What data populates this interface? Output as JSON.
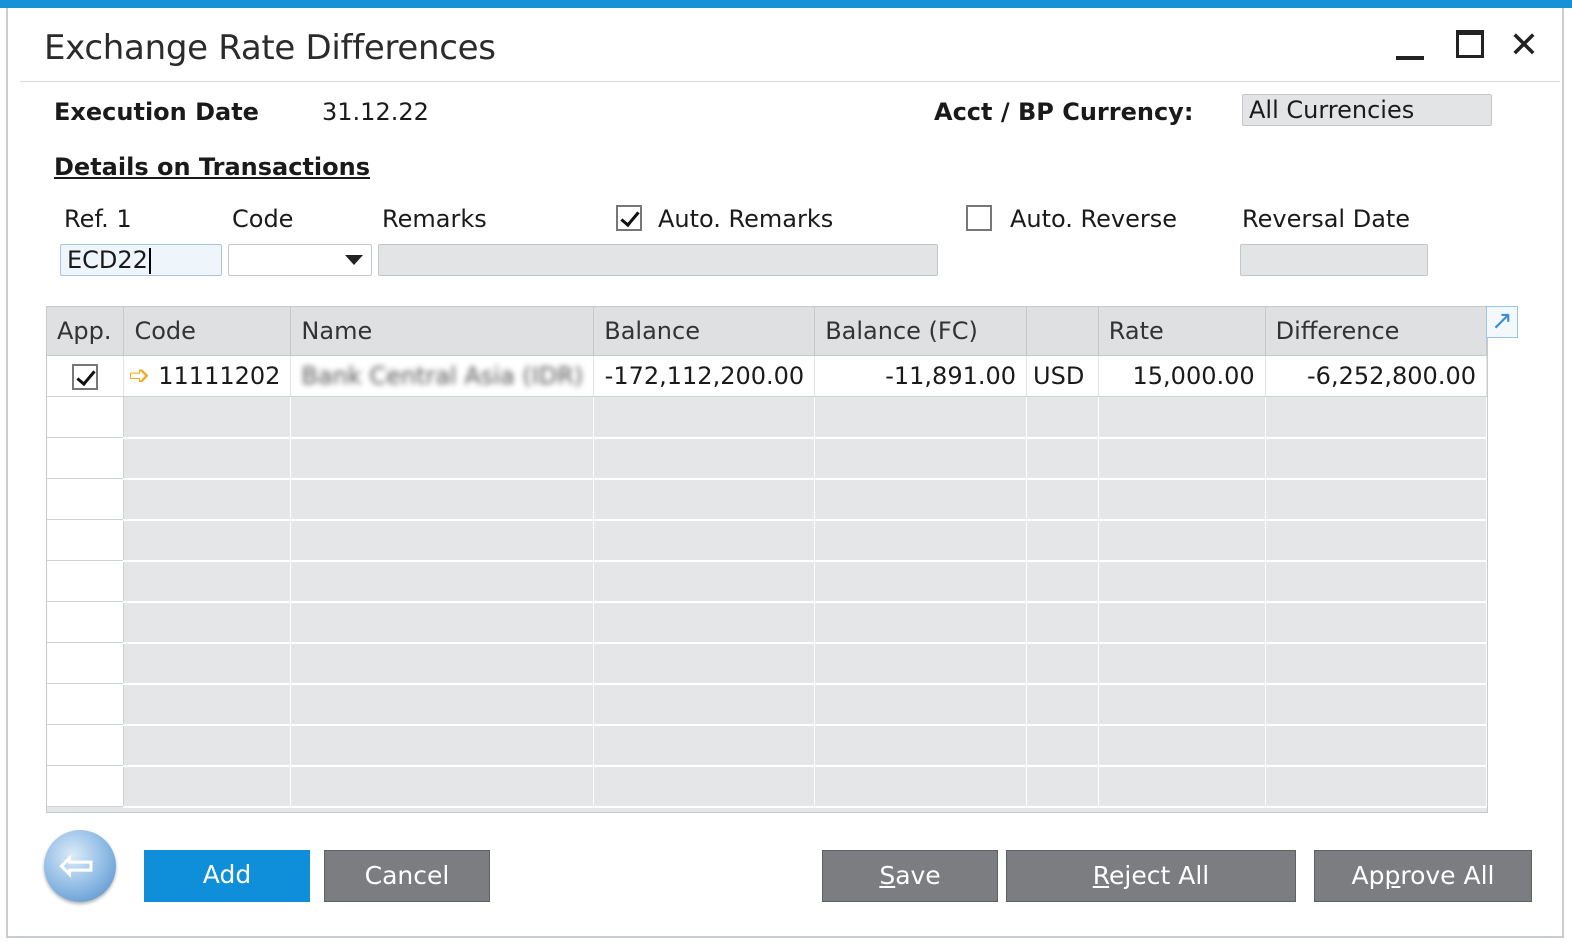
{
  "window": {
    "title": "Exchange Rate Differences"
  },
  "header": {
    "execution_date_label": "Execution Date",
    "execution_date_value": "31.12.22",
    "currency_label": "Acct / BP Currency:",
    "currency_value": "All Currencies"
  },
  "details": {
    "link": "Details on Transactions",
    "ref1_label": "Ref. 1",
    "ref1_value": "ECD22",
    "code_label": "Code",
    "code_value": "",
    "remarks_label": "Remarks",
    "remarks_value": "",
    "auto_remarks_label": "Auto. Remarks",
    "auto_remarks_checked": true,
    "auto_reverse_label": "Auto. Reverse",
    "auto_reverse_checked": false,
    "reversal_date_label": "Reversal Date",
    "reversal_date_value": ""
  },
  "table": {
    "columns": [
      "App.",
      "Code",
      "Name",
      "Balance",
      "Balance (FC)",
      "",
      "Rate",
      "Difference"
    ],
    "rows": [
      {
        "approved": true,
        "code": "11111202",
        "name": "Bank Central Asia (IDR)",
        "balance": "-172,112,200.00",
        "balance_fc": "-11,891.00",
        "currency": "USD",
        "rate": "15,000.00",
        "difference": "-6,252,800.00"
      }
    ],
    "empty_rows": 10
  },
  "buttons": {
    "add": "Add",
    "cancel": "Cancel",
    "save_u": "S",
    "save_rest": "ave",
    "reject_u": "R",
    "reject_rest": "eject All",
    "approve_pre": "Ap",
    "approve_u": "p",
    "approve_rest": "rove All"
  },
  "colors": {
    "accent": "#0f8ed9",
    "button_gray": "#7b7d80",
    "link_arrow": "#f0a81c"
  }
}
